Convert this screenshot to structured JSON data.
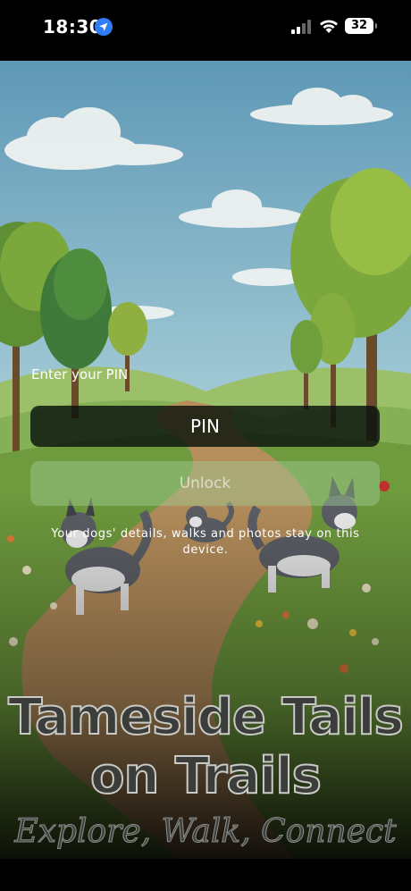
{
  "status_bar": {
    "time": "18:30",
    "battery": "32"
  },
  "icons": {
    "location": "location-arrow-icon",
    "signal": "cellular-signal-icon",
    "wifi": "wifi-icon",
    "battery": "battery-icon"
  },
  "lock_screen": {
    "pin_label": "Enter your PIN",
    "pin_placeholder": "PIN",
    "pin_value": "",
    "unlock_label": "Unlock",
    "privacy_note": "Your dogs' details, walks and photos stay on this device."
  },
  "branding": {
    "title_line_1": "Tameside Tails",
    "title_line_2": "on Trails",
    "tagline": "Explore, Walk, Connect"
  },
  "colors": {
    "sky": "#6fa6c2",
    "grass": "#7aa54a",
    "path": "#b08a5a",
    "accent_button": "#a0cd96"
  }
}
